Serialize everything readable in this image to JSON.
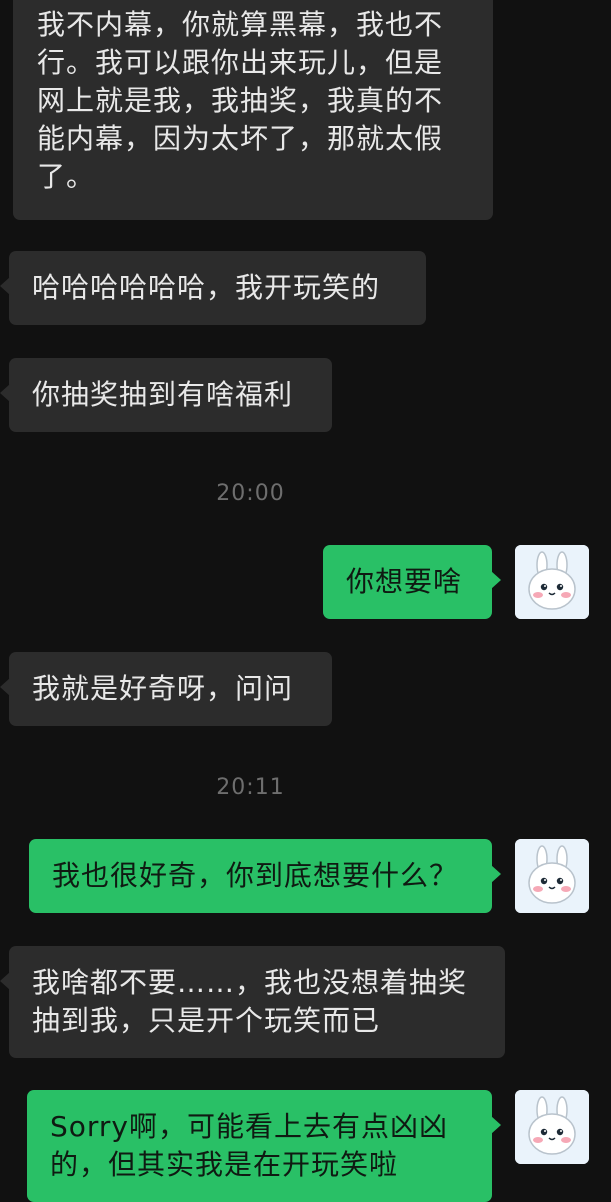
{
  "conversation": {
    "messages": [
      {
        "sender": "other",
        "text": "我不内幕，你就算黑幕，我也不\n行。我可以跟你出来玩儿，但是\n网上就是我，我抽奖，我真的不\n能内幕，因为太坏了，那就太假\n了。"
      },
      {
        "sender": "other",
        "text": "哈哈哈哈哈哈，我开玩笑的"
      },
      {
        "sender": "other",
        "text": "你抽奖抽到有啥福利"
      },
      {
        "sender": "system",
        "text": "20:00"
      },
      {
        "sender": "me",
        "text": "你想要啥"
      },
      {
        "sender": "other",
        "text": "我就是好奇呀，问问"
      },
      {
        "sender": "system",
        "text": "20:11"
      },
      {
        "sender": "me",
        "text": "我也很好奇，你到底想要什么？"
      },
      {
        "sender": "other",
        "text": "我啥都不要……，我也没想着抽奖\n抽到我，只是开个玩笑而已"
      },
      {
        "sender": "me",
        "text": "Sorry啊，可能看上去有点凶凶\n的，但其实我是在开玩笑啦"
      }
    ]
  },
  "avatar": {
    "icon": "bunny-avatar-icon"
  },
  "colors": {
    "background": "#111111",
    "incoming_bubble": "#2c2c2c",
    "outgoing_bubble": "#29c066",
    "timestamp_text": "#6e6e6e"
  }
}
